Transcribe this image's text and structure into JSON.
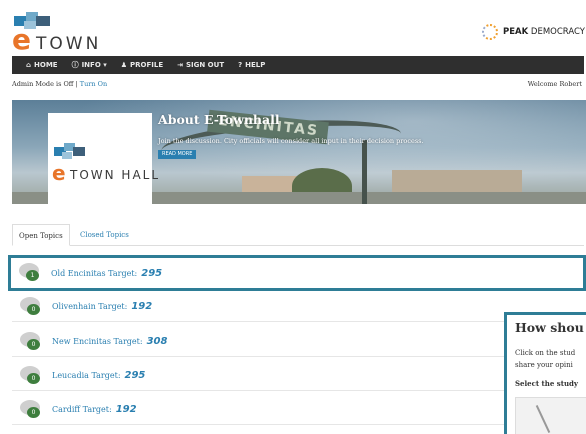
{
  "header": {
    "logo_e": "e",
    "logo_text": "TOWN HALL",
    "partner_prefix": "PEAK",
    "partner_suffix": " DEMOCRACY"
  },
  "nav": {
    "items": [
      {
        "icon": "⌂",
        "label": "HOME"
      },
      {
        "icon": "ⓘ",
        "label": "INFO ▾"
      },
      {
        "icon": "♟",
        "label": "PROFILE"
      },
      {
        "icon": "⇥",
        "label": "SIGN OUT"
      },
      {
        "icon": "?",
        "label": "HELP"
      }
    ]
  },
  "admin": {
    "status": "Admin Mode is Off | ",
    "toggle": "Turn On",
    "welcome": "Welcome Robert"
  },
  "banner": {
    "title": "About E-Townhall",
    "subtitle": "Join the discussion. City officials will consider all input in their decision process.",
    "button": "READ MORE",
    "sign_text": "ENCINITAS",
    "logo_e": "e",
    "logo_text": "TOWN HALL"
  },
  "tabs": {
    "open": "Open Topics",
    "closed": "Closed Topics"
  },
  "topics": [
    {
      "label": "Old Encinitas Target:",
      "count": "295",
      "badge": "1"
    },
    {
      "label": "Olivenhain Target:",
      "count": "192",
      "badge": "0"
    },
    {
      "label": "New Encinitas Target:",
      "count": "308",
      "badge": "0"
    },
    {
      "label": "Leucadia Target:",
      "count": "295",
      "badge": "0"
    },
    {
      "label": "Cardiff Target:",
      "count": "192",
      "badge": "0"
    }
  ],
  "popup": {
    "title": "How shou",
    "line1": "Click on the stud",
    "line2": "share your opini",
    "line3": "Select the study"
  },
  "colors": {
    "accent": "#2a7fb0",
    "frame": "#2e7d96",
    "logo_orange": "#e8752a",
    "nav_bg": "#2f2f2f"
  }
}
